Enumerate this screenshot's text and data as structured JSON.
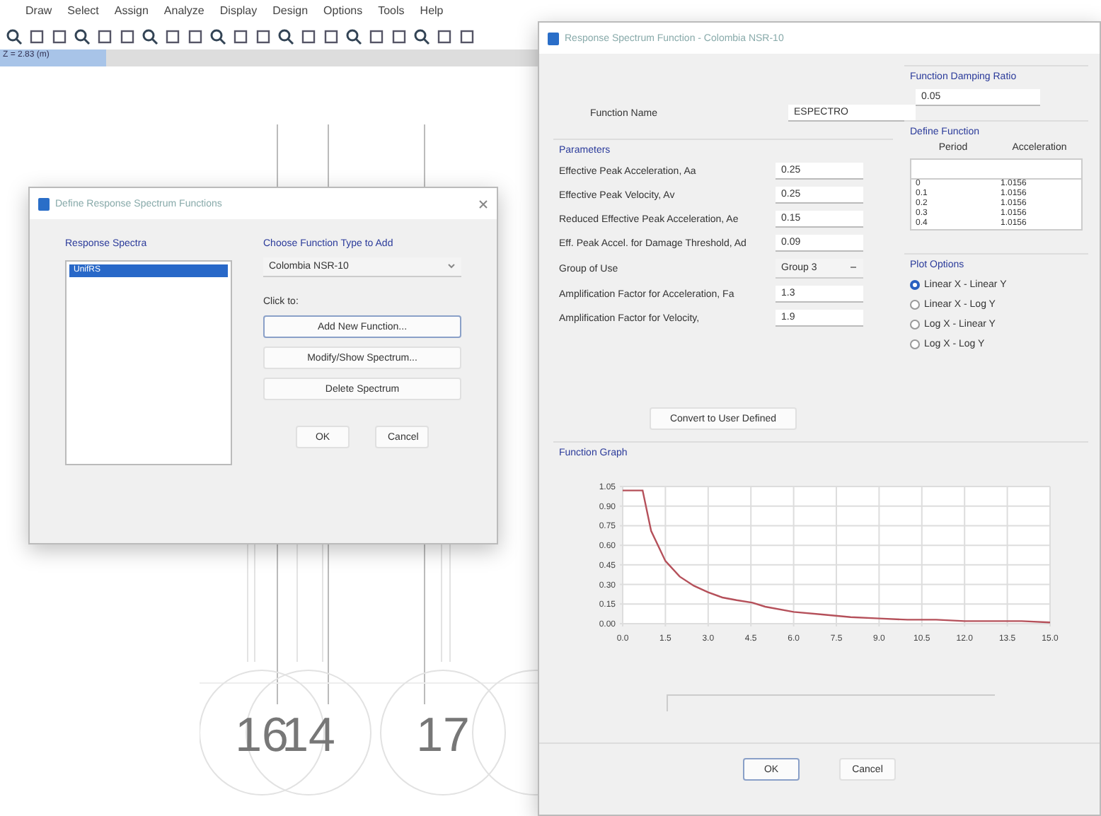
{
  "app": {
    "menu": [
      "Draw",
      "Select",
      "Assign",
      "Analyze",
      "Display",
      "Design",
      "Options",
      "Tools",
      "Help"
    ],
    "view_tab": {
      "label": "Z = 2.83 (m)",
      "selected": true
    },
    "grid_bubbles": [
      "16",
      "14",
      "17"
    ]
  },
  "define_dialog": {
    "title": "Define Response Spectrum Functions",
    "list_label": "Response Spectra",
    "functions": [
      {
        "label": "UnifRS",
        "selected": true
      }
    ],
    "type_label": "Choose Function Type to Add",
    "type_value": "Colombia NSR-10",
    "click_label": "Click to:",
    "actions": [
      "Add New Function...",
      "Modify/Show Spectrum...",
      "Delete Spectrum"
    ],
    "buttons": [
      "OK",
      "Cancel"
    ]
  },
  "spectrum_dialog": {
    "title": "Response Spectrum Function - Colombia NSR-10",
    "function_name": {
      "label": "Function Name",
      "value": "ESPECTRO"
    },
    "damping": {
      "title": "Function Damping Ratio",
      "value": "0.05"
    },
    "parameters": {
      "title": "Parameters",
      "rows": [
        {
          "kind": "field",
          "label": "Effective Peak Acceleration, Aa",
          "value": "0.25"
        },
        {
          "kind": "field",
          "label": "Effective Peak Velocity, Av",
          "value": "0.25"
        },
        {
          "kind": "field",
          "label": "Reduced Effective Peak Acceleration, Ae",
          "value": "0.15"
        },
        {
          "kind": "field",
          "label": "Eff. Peak Accel. for Damage Threshold, Ad",
          "value": "0.09"
        },
        {
          "kind": "select",
          "label": "Group of Use",
          "value": "Group 3"
        },
        {
          "kind": "field",
          "label": "Amplification Factor for Acceleration, Fa",
          "value": "1.3"
        },
        {
          "kind": "field",
          "label": "Amplification Factor for Velocity,",
          "value": "1.9"
        }
      ],
      "convert_button": "Convert to User Defined"
    },
    "define_function": {
      "title": "Define Function",
      "columns": [
        "Period",
        "Acceleration"
      ],
      "rows": [
        [
          "0",
          "1.0156"
        ],
        [
          "0.1",
          "1.0156"
        ],
        [
          "0.2",
          "1.0156"
        ],
        [
          "0.3",
          "1.0156"
        ],
        [
          "0.4",
          "1.0156"
        ]
      ]
    },
    "plot_options": {
      "title": "Plot Options",
      "options": [
        {
          "label": "Linear X - Linear Y",
          "selected": true
        },
        {
          "label": "Linear X - Log Y",
          "selected": false
        },
        {
          "label": "Log X - Linear Y",
          "selected": false
        },
        {
          "label": "Log X - Log Y",
          "selected": false
        }
      ]
    },
    "graph": {
      "title": "Function Graph",
      "chart_data": {
        "type": "line",
        "x": [
          0,
          0.7,
          1.0,
          1.5,
          2.0,
          2.5,
          3.0,
          3.5,
          4.0,
          4.56,
          5.0,
          6.0,
          7.0,
          8.0,
          9.0,
          10.0,
          11.0,
          12.0,
          13.0,
          14.0,
          15.0
        ],
        "series": [
          {
            "color": "#b5505a",
            "values": [
              1.02,
              1.02,
              0.71,
              0.48,
              0.36,
              0.29,
              0.24,
              0.2,
              0.18,
              0.16,
              0.13,
              0.09,
              0.07,
              0.05,
              0.04,
              0.03,
              0.03,
              0.02,
              0.02,
              0.02,
              0.01
            ]
          }
        ],
        "grid": true,
        "xlim": [
          0,
          15
        ],
        "ylim": [
          0,
          1.05
        ],
        "xticks": [
          {
            "value": 0,
            "label": "0.0"
          },
          {
            "value": 1.5,
            "label": "1.5"
          },
          {
            "value": 3,
            "label": "3.0"
          },
          {
            "value": 4.5,
            "label": "4.5"
          },
          {
            "value": 6,
            "label": "6.0"
          },
          {
            "value": 7.5,
            "label": "7.5"
          },
          {
            "value": 9,
            "label": "9.0"
          },
          {
            "value": 10.5,
            "label": "10.5"
          },
          {
            "value": 12,
            "label": "12.0"
          },
          {
            "value": 13.5,
            "label": "13.5"
          },
          {
            "value": 15,
            "label": "15.0"
          }
        ],
        "yticks": [
          {
            "value": 0,
            "label": "0.00"
          },
          {
            "value": 0.15,
            "label": "0.15"
          },
          {
            "value": 0.3,
            "label": "0.30"
          },
          {
            "value": 0.45,
            "label": "0.45"
          },
          {
            "value": 0.6,
            "label": "0.60"
          },
          {
            "value": 0.75,
            "label": "0.75"
          },
          {
            "value": 0.9,
            "label": "0.90"
          },
          {
            "value": 1.05,
            "label": "1.05"
          }
        ]
      }
    },
    "buttons": [
      "OK",
      "Cancel"
    ]
  }
}
